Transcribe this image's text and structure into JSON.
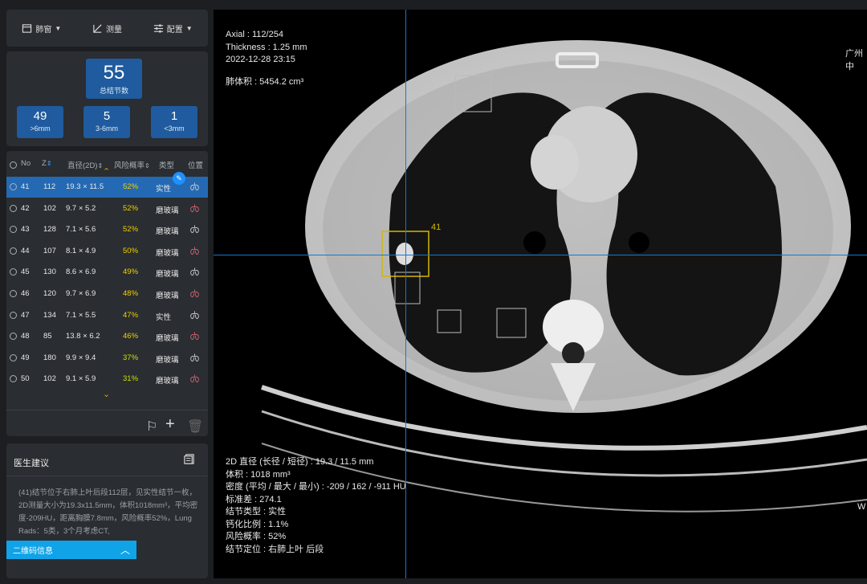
{
  "toolbar": {
    "lung_window": "肺窗",
    "measure": "测量",
    "config": "配置"
  },
  "stats": {
    "total": {
      "value": "55",
      "label": "总结节数"
    },
    "gt6": {
      "value": "49",
      "label": ">6mm"
    },
    "mid": {
      "value": "5",
      "label": "3-6mm"
    },
    "lt3": {
      "value": "1",
      "label": "<3mm"
    }
  },
  "table": {
    "headers": {
      "no": "No",
      "z": "Z",
      "diam": "直径(2D)",
      "risk": "风险概率",
      "type": "类型",
      "loc": "位置"
    },
    "rows": [
      {
        "no": "41",
        "z": "112",
        "diam": "19.3 × 11.5",
        "risk": "52%",
        "type": "实性"
      },
      {
        "no": "42",
        "z": "102",
        "diam": "9.7 × 5.2",
        "risk": "52%",
        "type": "磨玻璃"
      },
      {
        "no": "43",
        "z": "128",
        "diam": "7.1 × 5.6",
        "risk": "52%",
        "type": "磨玻璃"
      },
      {
        "no": "44",
        "z": "107",
        "diam": "8.1 × 4.9",
        "risk": "50%",
        "type": "磨玻璃"
      },
      {
        "no": "45",
        "z": "130",
        "diam": "8.6 × 6.9",
        "risk": "49%",
        "type": "磨玻璃"
      },
      {
        "no": "46",
        "z": "120",
        "diam": "9.7 × 6.9",
        "risk": "48%",
        "type": "磨玻璃"
      },
      {
        "no": "47",
        "z": "134",
        "diam": "7.1 × 5.5",
        "risk": "47%",
        "type": "实性"
      },
      {
        "no": "48",
        "z": "85",
        "diam": "13.8 × 6.2",
        "risk": "46%",
        "type": "磨玻璃"
      },
      {
        "no": "49",
        "z": "180",
        "diam": "9.9 × 9.4",
        "risk": "37%",
        "type": "磨玻璃"
      },
      {
        "no": "50",
        "z": "102",
        "diam": "9.1 × 5.9",
        "risk": "31%",
        "type": "磨玻璃"
      }
    ]
  },
  "advice": {
    "title": "医生建议",
    "text": "(41)结节位于右肺上叶后段112层，见实性结节一枚，2D测量大小为19.3x11.5mm，体积1018mm³，平均密度-209HU，距离胸膜7.8mm，风险概率52%，Lung Rads：5类，3个月考虑CT,"
  },
  "qr_label": "二维码信息",
  "viewer": {
    "axial": "Axial : 112/254",
    "thickness": "Thickness : 1.25 mm",
    "datetime": "2022-12-28 23:15",
    "lung_volume": "肺体积 : 5454.2 cm³",
    "hospital": "广州中",
    "right_edge": "W",
    "nodule_label": "41",
    "info": [
      "2D 直径 (长径 / 短径) : 19.3 / 11.5 mm",
      "体积 : 1018 mm³",
      "密度 (平均 / 最大 / 最小) : -209 / 162 / -911 HU",
      "标准差 : 274.1",
      "结节类型 : 实性",
      "钙化比例 : 1.1%",
      "风险概率 : 52%",
      "结节定位 : 右肺上叶 后段"
    ]
  }
}
